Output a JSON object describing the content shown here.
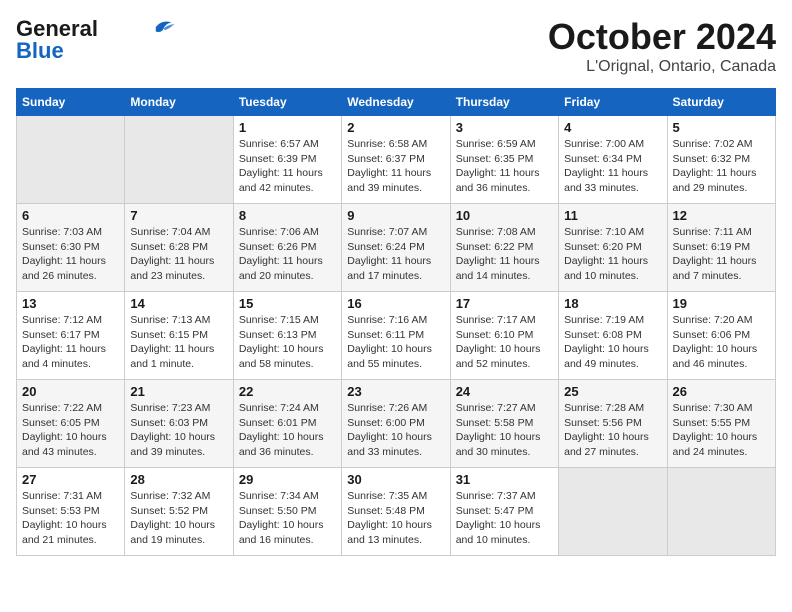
{
  "header": {
    "logo_line1": "General",
    "logo_line2": "Blue",
    "month": "October 2024",
    "location": "L'Orignal, Ontario, Canada"
  },
  "weekdays": [
    "Sunday",
    "Monday",
    "Tuesday",
    "Wednesday",
    "Thursday",
    "Friday",
    "Saturday"
  ],
  "weeks": [
    [
      {
        "day": "",
        "info": ""
      },
      {
        "day": "",
        "info": ""
      },
      {
        "day": "1",
        "info": "Sunrise: 6:57 AM\nSunset: 6:39 PM\nDaylight: 11 hours and 42 minutes."
      },
      {
        "day": "2",
        "info": "Sunrise: 6:58 AM\nSunset: 6:37 PM\nDaylight: 11 hours and 39 minutes."
      },
      {
        "day": "3",
        "info": "Sunrise: 6:59 AM\nSunset: 6:35 PM\nDaylight: 11 hours and 36 minutes."
      },
      {
        "day": "4",
        "info": "Sunrise: 7:00 AM\nSunset: 6:34 PM\nDaylight: 11 hours and 33 minutes."
      },
      {
        "day": "5",
        "info": "Sunrise: 7:02 AM\nSunset: 6:32 PM\nDaylight: 11 hours and 29 minutes."
      }
    ],
    [
      {
        "day": "6",
        "info": "Sunrise: 7:03 AM\nSunset: 6:30 PM\nDaylight: 11 hours and 26 minutes."
      },
      {
        "day": "7",
        "info": "Sunrise: 7:04 AM\nSunset: 6:28 PM\nDaylight: 11 hours and 23 minutes."
      },
      {
        "day": "8",
        "info": "Sunrise: 7:06 AM\nSunset: 6:26 PM\nDaylight: 11 hours and 20 minutes."
      },
      {
        "day": "9",
        "info": "Sunrise: 7:07 AM\nSunset: 6:24 PM\nDaylight: 11 hours and 17 minutes."
      },
      {
        "day": "10",
        "info": "Sunrise: 7:08 AM\nSunset: 6:22 PM\nDaylight: 11 hours and 14 minutes."
      },
      {
        "day": "11",
        "info": "Sunrise: 7:10 AM\nSunset: 6:20 PM\nDaylight: 11 hours and 10 minutes."
      },
      {
        "day": "12",
        "info": "Sunrise: 7:11 AM\nSunset: 6:19 PM\nDaylight: 11 hours and 7 minutes."
      }
    ],
    [
      {
        "day": "13",
        "info": "Sunrise: 7:12 AM\nSunset: 6:17 PM\nDaylight: 11 hours and 4 minutes."
      },
      {
        "day": "14",
        "info": "Sunrise: 7:13 AM\nSunset: 6:15 PM\nDaylight: 11 hours and 1 minute."
      },
      {
        "day": "15",
        "info": "Sunrise: 7:15 AM\nSunset: 6:13 PM\nDaylight: 10 hours and 58 minutes."
      },
      {
        "day": "16",
        "info": "Sunrise: 7:16 AM\nSunset: 6:11 PM\nDaylight: 10 hours and 55 minutes."
      },
      {
        "day": "17",
        "info": "Sunrise: 7:17 AM\nSunset: 6:10 PM\nDaylight: 10 hours and 52 minutes."
      },
      {
        "day": "18",
        "info": "Sunrise: 7:19 AM\nSunset: 6:08 PM\nDaylight: 10 hours and 49 minutes."
      },
      {
        "day": "19",
        "info": "Sunrise: 7:20 AM\nSunset: 6:06 PM\nDaylight: 10 hours and 46 minutes."
      }
    ],
    [
      {
        "day": "20",
        "info": "Sunrise: 7:22 AM\nSunset: 6:05 PM\nDaylight: 10 hours and 43 minutes."
      },
      {
        "day": "21",
        "info": "Sunrise: 7:23 AM\nSunset: 6:03 PM\nDaylight: 10 hours and 39 minutes."
      },
      {
        "day": "22",
        "info": "Sunrise: 7:24 AM\nSunset: 6:01 PM\nDaylight: 10 hours and 36 minutes."
      },
      {
        "day": "23",
        "info": "Sunrise: 7:26 AM\nSunset: 6:00 PM\nDaylight: 10 hours and 33 minutes."
      },
      {
        "day": "24",
        "info": "Sunrise: 7:27 AM\nSunset: 5:58 PM\nDaylight: 10 hours and 30 minutes."
      },
      {
        "day": "25",
        "info": "Sunrise: 7:28 AM\nSunset: 5:56 PM\nDaylight: 10 hours and 27 minutes."
      },
      {
        "day": "26",
        "info": "Sunrise: 7:30 AM\nSunset: 5:55 PM\nDaylight: 10 hours and 24 minutes."
      }
    ],
    [
      {
        "day": "27",
        "info": "Sunrise: 7:31 AM\nSunset: 5:53 PM\nDaylight: 10 hours and 21 minutes."
      },
      {
        "day": "28",
        "info": "Sunrise: 7:32 AM\nSunset: 5:52 PM\nDaylight: 10 hours and 19 minutes."
      },
      {
        "day": "29",
        "info": "Sunrise: 7:34 AM\nSunset: 5:50 PM\nDaylight: 10 hours and 16 minutes."
      },
      {
        "day": "30",
        "info": "Sunrise: 7:35 AM\nSunset: 5:48 PM\nDaylight: 10 hours and 13 minutes."
      },
      {
        "day": "31",
        "info": "Sunrise: 7:37 AM\nSunset: 5:47 PM\nDaylight: 10 hours and 10 minutes."
      },
      {
        "day": "",
        "info": ""
      },
      {
        "day": "",
        "info": ""
      }
    ]
  ]
}
